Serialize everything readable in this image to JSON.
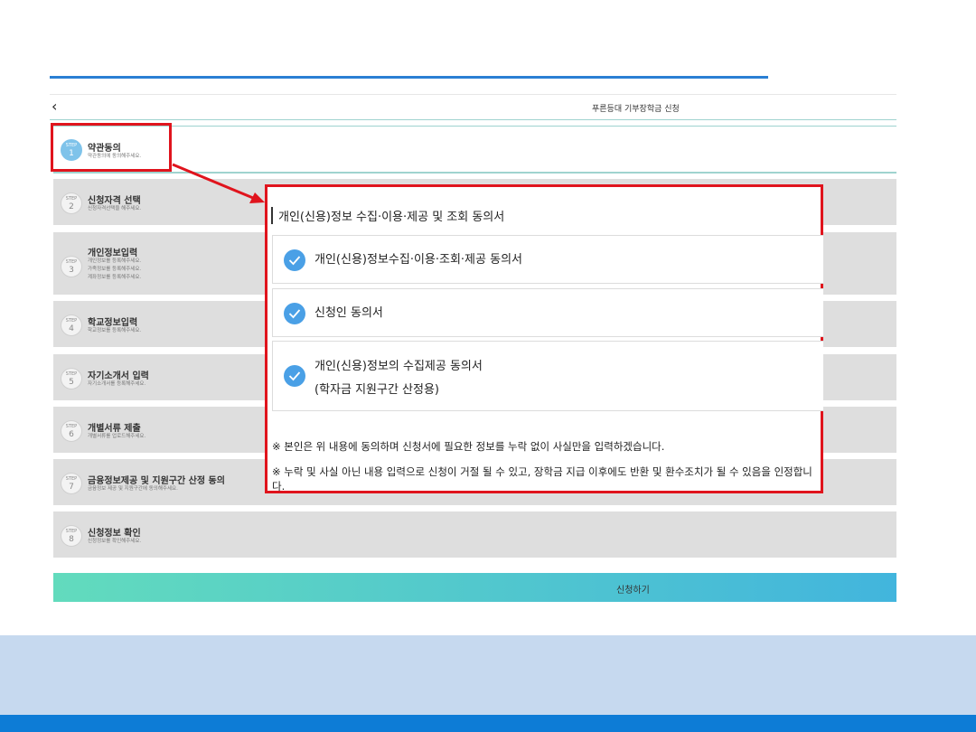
{
  "header": {
    "back_icon": "chevron-left-icon",
    "back_glyph": "‹",
    "title": "푸른등대 기부장학금 신청"
  },
  "steps": [
    {
      "label": "STEP",
      "num": "1",
      "title": "약관동의",
      "subs": [
        "약관동의에 동의해주세요."
      ],
      "active": true
    },
    {
      "label": "STEP",
      "num": "2",
      "title": "신청자격 선택",
      "subs": [
        "신청자격선택을 해주세요."
      ]
    },
    {
      "label": "STEP",
      "num": "3",
      "title": "개인정보입력",
      "subs": [
        "개인정보를 등록해주세요.",
        "가족정보를 등록해주세요.",
        "계좌정보를 등록해주세요."
      ]
    },
    {
      "label": "STEP",
      "num": "4",
      "title": "학교정보입력",
      "subs": [
        "학교정보를 등록해주세요."
      ]
    },
    {
      "label": "STEP",
      "num": "5",
      "title": "자기소개서 입력",
      "subs": [
        "자기소개서를 등록해주세요."
      ]
    },
    {
      "label": "STEP",
      "num": "6",
      "title": "개별서류 제출",
      "subs": [
        "개별서류를 업로드해주세요."
      ]
    },
    {
      "label": "STEP",
      "num": "7",
      "title": "금융정보제공 및 지원구간 산정 동의",
      "subs": [
        "금융정보 제공 및 지원구간에 동의해주세요."
      ]
    },
    {
      "label": "STEP",
      "num": "8",
      "title": "신청정보 확인",
      "subs": [
        "신청정보를 확인해주세요."
      ]
    }
  ],
  "submit_label": "신청하기",
  "popup": {
    "title": "개인(신용)정보 수집·이용·제공 및 조회 동의서",
    "items": [
      {
        "lines": [
          "개인(신용)정보수집·이용·조회·제공 동의서"
        ],
        "checked": true
      },
      {
        "lines": [
          "신청인 동의서"
        ],
        "checked": true
      },
      {
        "lines": [
          "개인(신용)정보의 수집제공 동의서",
          "(학자금 지원구간 산정용)"
        ],
        "checked": true
      }
    ],
    "notices": [
      "※ 본인은 위 내용에 동의하며 신청서에 필요한 정보를 누락 없이 사실만을 입력하겠습니다.",
      "※ 누락 및 사실 아닌 내용 입력으로 신청이 거절 될 수 있고, 장학금 지급 이후에도 반환 및 환수조치가 될 수 있음을 인정합니다."
    ]
  },
  "colors": {
    "accent": "#2a7fd4",
    "highlight": "#e0141d",
    "check": "#4aa0e6",
    "footer": "#0d7cd6",
    "footer_band": "#c6d9ef"
  }
}
